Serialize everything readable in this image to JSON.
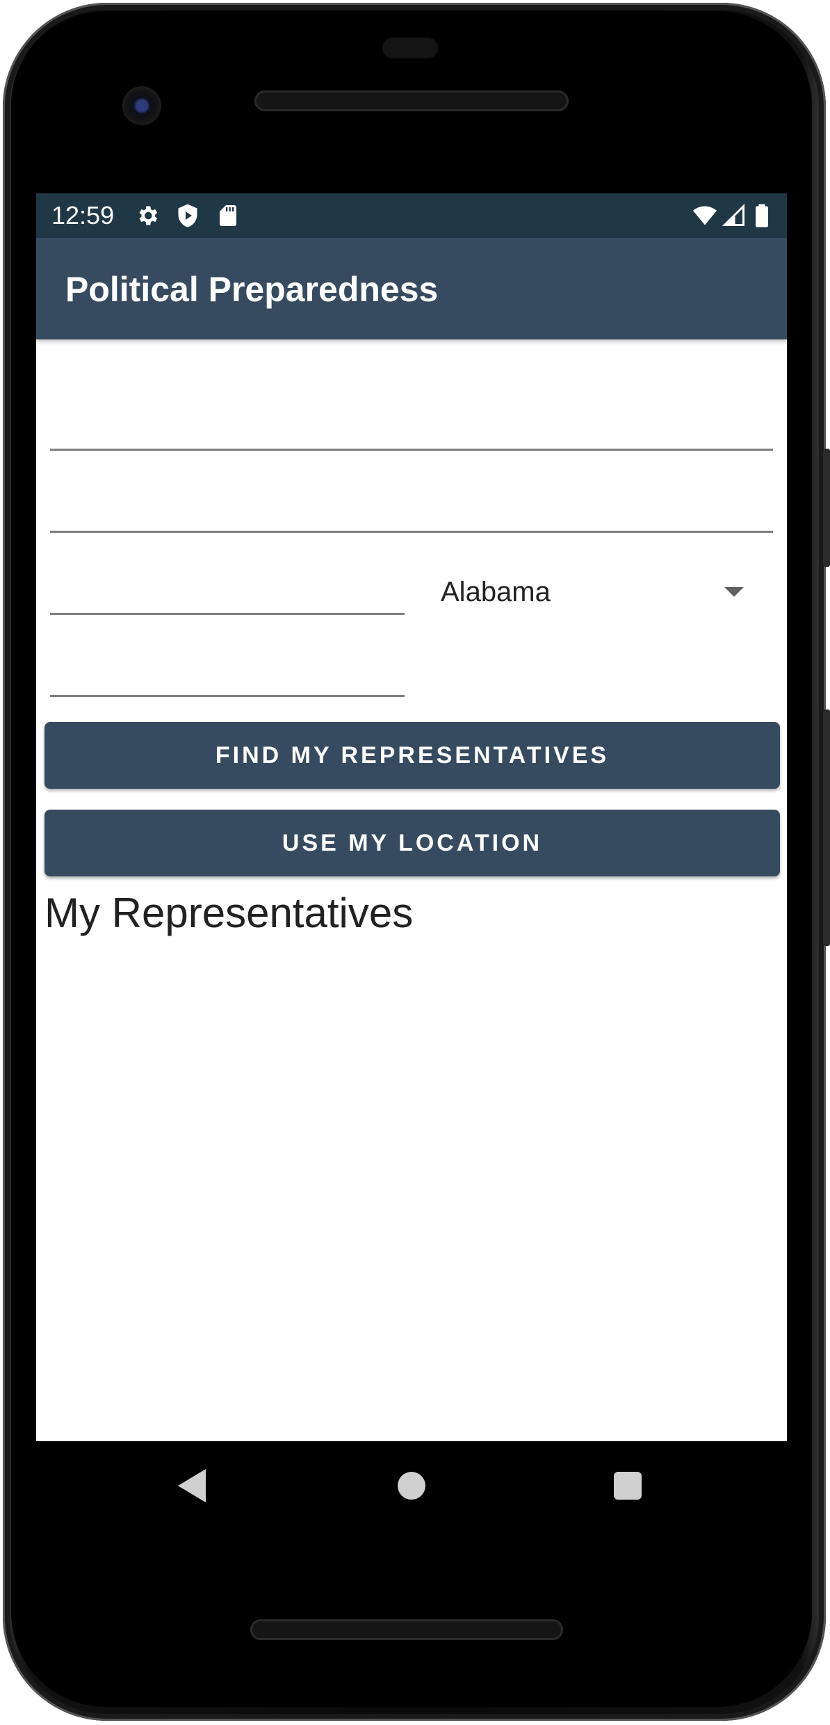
{
  "status_bar": {
    "time": "12:59",
    "left_icons": [
      "gear-icon",
      "shield-play-icon",
      "sd-card-icon"
    ],
    "right_icons": [
      "wifi-icon",
      "signal-icon",
      "battery-icon"
    ]
  },
  "app_bar": {
    "title": "Political Preparedness"
  },
  "form": {
    "address_line_1": {
      "value": "",
      "placeholder": ""
    },
    "address_line_2": {
      "value": "",
      "placeholder": ""
    },
    "city": {
      "value": "",
      "placeholder": ""
    },
    "zip": {
      "value": "",
      "placeholder": ""
    },
    "state": {
      "selected": "Alabama"
    }
  },
  "buttons": {
    "find": "FIND MY REPRESENTATIVES",
    "location": "USE MY LOCATION"
  },
  "representatives": {
    "heading": "My Representatives"
  },
  "colors": {
    "status_bar": "#203746",
    "primary": "#374b60",
    "on_primary": "#ffffff"
  },
  "nav_bar": {
    "icons": [
      "back-icon",
      "home-icon",
      "recents-icon"
    ]
  }
}
